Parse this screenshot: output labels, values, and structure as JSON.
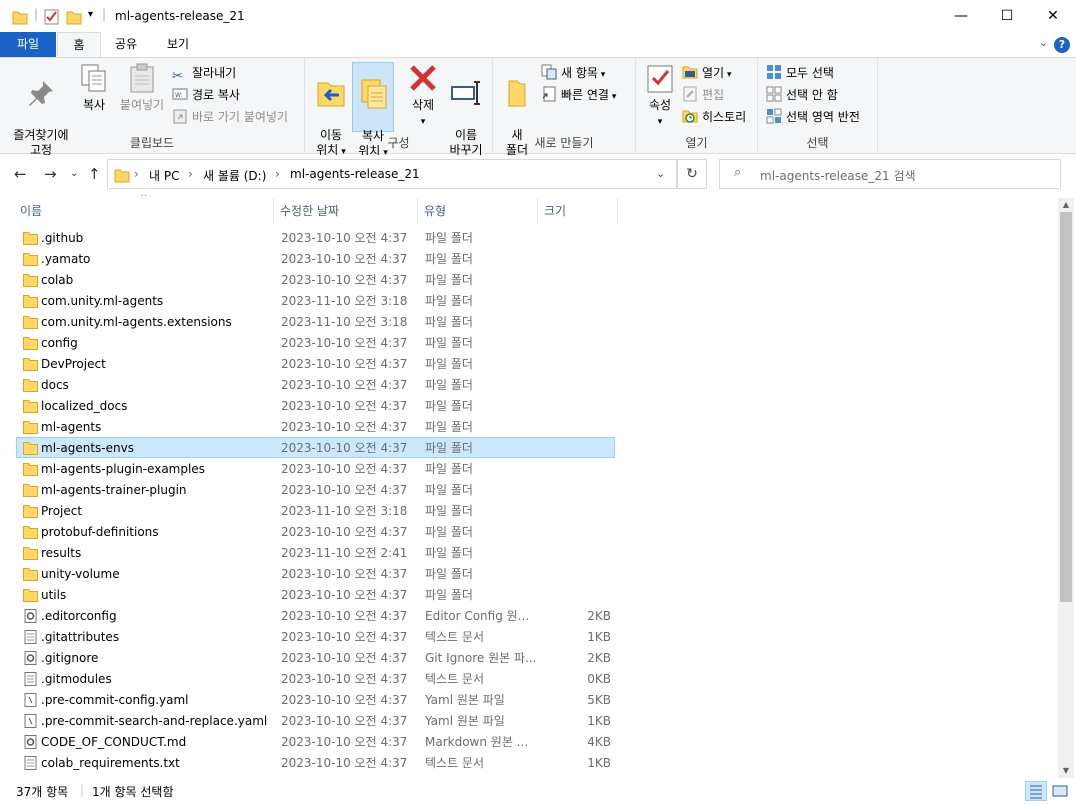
{
  "window": {
    "title": "ml-agents-release_21",
    "minimize": "—",
    "maximize": "☐",
    "close": "✕"
  },
  "ribbon_tabs": [
    "파일",
    "홈",
    "공유",
    "보기"
  ],
  "help": "?",
  "clipboard": {
    "label": "클립보드",
    "pin": "즐겨찾기에\n고정",
    "copy": "복사",
    "paste": "붙여넣기",
    "cut": "잘라내기",
    "copy_path": "경로 복사",
    "paste_shortcut": "바로 가기 붙여넣기"
  },
  "organize": {
    "label": "구성",
    "move_to": "이동\n위치",
    "copy_to": "복사\n위치",
    "delete": "삭제",
    "rename": "이름\n바꾸기"
  },
  "new": {
    "label": "새로 만들기",
    "new_folder": "새\n폴더",
    "new_item": "새 항목",
    "easy_access": "빠른 연결"
  },
  "open": {
    "label": "열기",
    "properties": "속성",
    "open": "열기",
    "edit": "편집",
    "history": "히스토리"
  },
  "select": {
    "label": "선택",
    "select_all": "모두 선택",
    "select_none": "선택 안 함",
    "invert": "선택 영역 반전"
  },
  "address": {
    "segments": [
      "내 PC",
      "새 볼륨 (D:)",
      "ml-agents-release_21"
    ],
    "search_placeholder": "ml-agents-release_21 검색"
  },
  "columns": {
    "name": "이름",
    "date": "수정한 날짜",
    "type": "유형",
    "size": "크기"
  },
  "files": [
    {
      "name": ".github",
      "date": "2023-10-10 오전 4:37",
      "type": "파일 폴더",
      "size": "",
      "kind": "folder"
    },
    {
      "name": ".yamato",
      "date": "2023-10-10 오전 4:37",
      "type": "파일 폴더",
      "size": "",
      "kind": "folder"
    },
    {
      "name": "colab",
      "date": "2023-10-10 오전 4:37",
      "type": "파일 폴더",
      "size": "",
      "kind": "folder"
    },
    {
      "name": "com.unity.ml-agents",
      "date": "2023-11-10 오전 3:18",
      "type": "파일 폴더",
      "size": "",
      "kind": "folder"
    },
    {
      "name": "com.unity.ml-agents.extensions",
      "date": "2023-11-10 오전 3:18",
      "type": "파일 폴더",
      "size": "",
      "kind": "folder"
    },
    {
      "name": "config",
      "date": "2023-10-10 오전 4:37",
      "type": "파일 폴더",
      "size": "",
      "kind": "folder"
    },
    {
      "name": "DevProject",
      "date": "2023-10-10 오전 4:37",
      "type": "파일 폴더",
      "size": "",
      "kind": "folder"
    },
    {
      "name": "docs",
      "date": "2023-10-10 오전 4:37",
      "type": "파일 폴더",
      "size": "",
      "kind": "folder"
    },
    {
      "name": "localized_docs",
      "date": "2023-10-10 오전 4:37",
      "type": "파일 폴더",
      "size": "",
      "kind": "folder"
    },
    {
      "name": "ml-agents",
      "date": "2023-10-10 오전 4:37",
      "type": "파일 폴더",
      "size": "",
      "kind": "folder"
    },
    {
      "name": "ml-agents-envs",
      "date": "2023-10-10 오전 4:37",
      "type": "파일 폴더",
      "size": "",
      "kind": "folder",
      "selected": true
    },
    {
      "name": "ml-agents-plugin-examples",
      "date": "2023-10-10 오전 4:37",
      "type": "파일 폴더",
      "size": "",
      "kind": "folder"
    },
    {
      "name": "ml-agents-trainer-plugin",
      "date": "2023-10-10 오전 4:37",
      "type": "파일 폴더",
      "size": "",
      "kind": "folder"
    },
    {
      "name": "Project",
      "date": "2023-11-10 오전 3:18",
      "type": "파일 폴더",
      "size": "",
      "kind": "folder"
    },
    {
      "name": "protobuf-definitions",
      "date": "2023-10-10 오전 4:37",
      "type": "파일 폴더",
      "size": "",
      "kind": "folder"
    },
    {
      "name": "results",
      "date": "2023-11-10 오전 2:41",
      "type": "파일 폴더",
      "size": "",
      "kind": "folder"
    },
    {
      "name": "unity-volume",
      "date": "2023-10-10 오전 4:37",
      "type": "파일 폴더",
      "size": "",
      "kind": "folder"
    },
    {
      "name": "utils",
      "date": "2023-10-10 오전 4:37",
      "type": "파일 폴더",
      "size": "",
      "kind": "folder"
    },
    {
      "name": ".editorconfig",
      "date": "2023-10-10 오전 4:37",
      "type": "Editor Config 원...",
      "size": "2KB",
      "kind": "config"
    },
    {
      "name": ".gitattributes",
      "date": "2023-10-10 오전 4:37",
      "type": "텍스트 문서",
      "size": "1KB",
      "kind": "text"
    },
    {
      "name": ".gitignore",
      "date": "2023-10-10 오전 4:37",
      "type": "Git Ignore 원본 파...",
      "size": "2KB",
      "kind": "config"
    },
    {
      "name": ".gitmodules",
      "date": "2023-10-10 오전 4:37",
      "type": "텍스트 문서",
      "size": "0KB",
      "kind": "text"
    },
    {
      "name": ".pre-commit-config.yaml",
      "date": "2023-10-10 오전 4:37",
      "type": "Yaml 원본 파일",
      "size": "5KB",
      "kind": "yaml"
    },
    {
      "name": ".pre-commit-search-and-replace.yaml",
      "date": "2023-10-10 오전 4:37",
      "type": "Yaml 원본 파일",
      "size": "1KB",
      "kind": "yaml"
    },
    {
      "name": "CODE_OF_CONDUCT.md",
      "date": "2023-10-10 오전 4:37",
      "type": "Markdown 원본 ...",
      "size": "4KB",
      "kind": "config"
    },
    {
      "name": "colab_requirements.txt",
      "date": "2023-10-10 오전 4:37",
      "type": "텍스트 문서",
      "size": "1KB",
      "kind": "text"
    }
  ],
  "status": {
    "count": "37개 항목",
    "selected": "1개 항목 선택함"
  },
  "colors": {
    "file_tab": "#1a63c4",
    "selection": "#cce8ff",
    "folder": "#ffd766"
  }
}
